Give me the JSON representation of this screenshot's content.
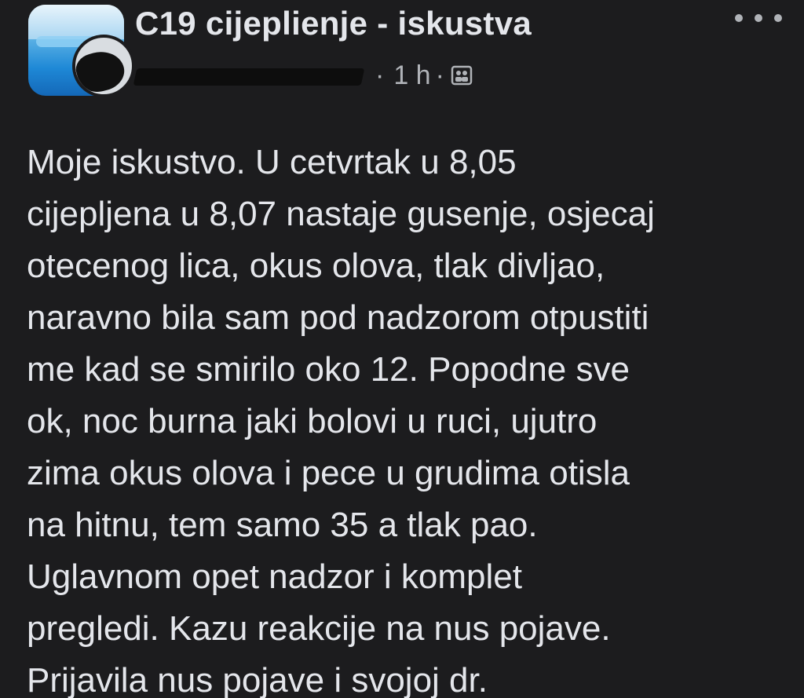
{
  "post": {
    "group_name": "C19 cijeplienje - iskustva",
    "time": "1 h",
    "lines": [
      "Moje iskustvo. U cetvrtak u 8,05",
      "cijepljena u 8,07 nastaje gusenje, osjecaj",
      "otecenog lica, okus olova, tlak divljao,",
      "naravno bila sam pod nadzorom otpustiti",
      "me kad se smirilo oko 12. Popodne sve",
      "ok, noc burna jaki bolovi u ruci, ujutro",
      "zima okus olova i pece u grudima otisla",
      "na hitnu, tem samo 35 a tlak pao.",
      "Uglavnom opet nadzor i komplet",
      "pregledi. Kazu reakcije na nus pojave.",
      "Prijavila nus pojave i svojoj dr."
    ]
  },
  "icons": {
    "more": "more-options-icon",
    "audience": "group-members-icon"
  },
  "colors": {
    "background": "#1c1c1e",
    "primary_text": "#e4e6eb",
    "secondary_text": "#b0b3b8"
  }
}
